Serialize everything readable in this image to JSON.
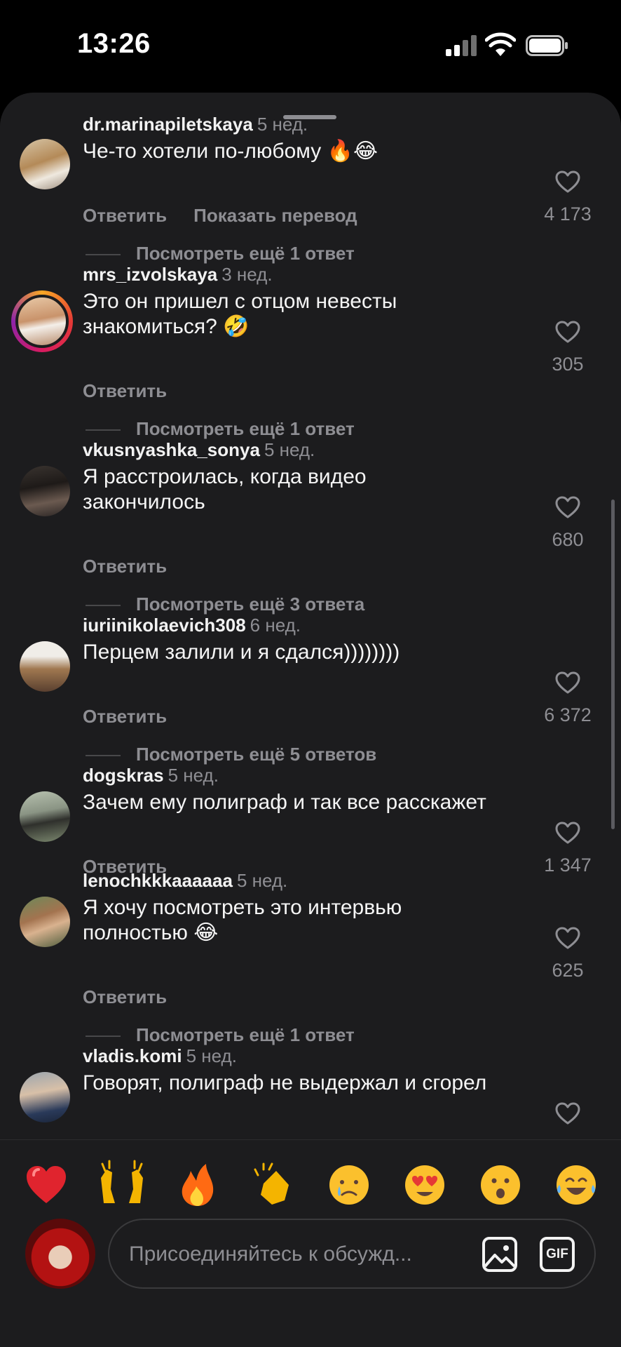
{
  "status_bar": {
    "time": "13:26"
  },
  "comments": [
    {
      "username": "dr.marinapiletskaya",
      "time": "5 нед.",
      "text": "Че-то хотели по-любому",
      "emoji": [
        "🔥",
        "😂"
      ],
      "actions": [
        "Ответить",
        "Показать перевод"
      ],
      "replies": "Посмотреть ещё 1 ответ",
      "likes": "4 173"
    },
    {
      "username": "mrs_izvolskaya",
      "time": "3 нед.",
      "text_line1": "Это он пришел с отцом невесты",
      "text_line2": "знакомиться?",
      "emoji": [
        "🤣"
      ],
      "actions": [
        "Ответить"
      ],
      "replies": "Посмотреть ещё 1 ответ",
      "likes": "305"
    },
    {
      "username": "vkusnyashka_sonya",
      "time": "5 нед.",
      "text_line1": "Я расстроилась, когда видео",
      "text_line2": "закончилось",
      "actions": [
        "Ответить"
      ],
      "replies": "Посмотреть ещё 3 ответа",
      "likes": "680"
    },
    {
      "username": "iuriinikolaevich308",
      "time": "6 нед.",
      "text": "Перцем залили и я сдался))))))))",
      "actions": [
        "Ответить"
      ],
      "replies": "Посмотреть ещё 5 ответов",
      "likes": "6 372"
    },
    {
      "username": "dogskras",
      "time": "5 нед.",
      "text": "Зачем ему полиграф и так все расскажет",
      "actions": [
        "Ответить"
      ],
      "likes": "1 347"
    },
    {
      "username": "lenochkkkaaaaaa",
      "time": "5 нед.",
      "text_line1": "Я хочу посмотреть это интервью",
      "text_line2": "полностью",
      "emoji": [
        "😂"
      ],
      "actions": [
        "Ответить"
      ],
      "replies": "Посмотреть ещё 1 ответ",
      "likes": "625"
    },
    {
      "username": "vladis.komi",
      "time": "5 нед.",
      "text": "Говорят, полиграф не выдержал и сгорел"
    }
  ],
  "reactions": [
    "❤️",
    "🙌",
    "🔥",
    "👏",
    "😢",
    "😍",
    "😮",
    "😂"
  ],
  "composer": {
    "placeholder": "Присоединяйтесь к обсужд...",
    "gif_label": "GIF"
  },
  "colors": {
    "sheet_bg": "#1c1c1e",
    "secondary_text": "#8e8e93",
    "primary_text": "#f2f2f2"
  }
}
